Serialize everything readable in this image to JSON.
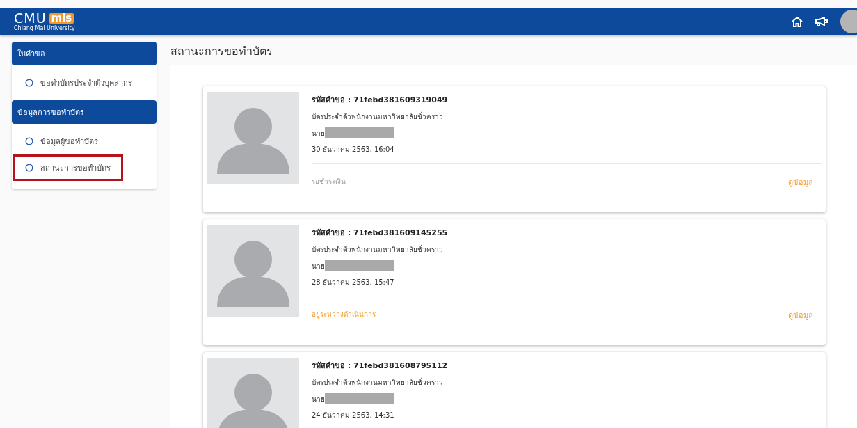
{
  "header": {
    "logo_main": "CMU",
    "logo_badge": "mis",
    "logo_sub": "Chiang Mai University"
  },
  "sidebar": {
    "sections": [
      {
        "title": "ใบคำขอ",
        "items": [
          {
            "label": "ขอทำบัตรประจำตัวบุคลากร",
            "highlighted": false
          }
        ]
      },
      {
        "title": "ข้อมูลการขอทำบัตร",
        "items": [
          {
            "label": "ข้อมูลผู้ขอทำบัตร",
            "highlighted": false
          },
          {
            "label": "สถานะการขอทำบัตร",
            "highlighted": true
          }
        ]
      }
    ]
  },
  "page_title": "สถานะการขอทำบัตร",
  "requests": [
    {
      "code": "รหัสคำขอ : 71febd381609319049",
      "card_type": "บัตรประจำตัวพนักงานมหาวิทยาลัยชั่วคราว",
      "name_prefix": "นาย",
      "date": "30 ธันวาคม 2563, 16:04",
      "status": "รอชำระเงิน",
      "kind": "pending",
      "action": "ดูข้อมูล"
    },
    {
      "code": "รหัสคำขอ : 71febd381609145255",
      "card_type": "บัตรประจำตัวพนักงานมหาวิทยาลัยชั่วคราว",
      "name_prefix": "นาย",
      "date": "28 ธันวาคม 2563, 15:47",
      "status": "อยู่ระหว่างดำเนินการ",
      "kind": "in_progress",
      "action": "ดูข้อมูล"
    },
    {
      "code": "รหัสคำขอ : 71febd381608795112",
      "card_type": "บัตรประจำตัวพนักงานมหาวิทยาลัยชั่วคราว",
      "name_prefix": "นาย",
      "date": "24 ธันวาคม 2563, 14:31"
    }
  ]
}
